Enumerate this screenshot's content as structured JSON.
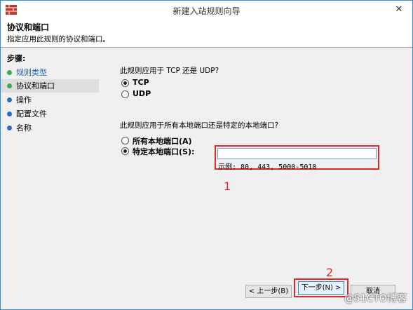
{
  "window": {
    "title": "新建入站规则向导",
    "close_icon": "close-icon",
    "accent": "#2b8fd8"
  },
  "header": {
    "title": "协议和端口",
    "subtitle": "指定应用此规则的协议和端口。"
  },
  "sidebar": {
    "heading": "步骤:",
    "steps": [
      {
        "label": "规则类型",
        "state": "done"
      },
      {
        "label": "协议和端口",
        "state": "current"
      },
      {
        "label": "操作",
        "state": "pending"
      },
      {
        "label": "配置文件",
        "state": "pending"
      },
      {
        "label": "名称",
        "state": "pending"
      }
    ]
  },
  "protocol": {
    "question": "此规则应用于 TCP 还是 UDP?",
    "options": [
      {
        "label": "TCP",
        "selected": true
      },
      {
        "label": "UDP",
        "selected": false
      }
    ]
  },
  "ports": {
    "question": "此规则应用于所有本地端口还是特定的本地端口?",
    "options": [
      {
        "label": "所有本地端口(A)",
        "selected": false
      },
      {
        "label": "特定本地端口(S):",
        "selected": true
      }
    ],
    "input_value": "",
    "hint": "示例: 80, 443, 5000-5010"
  },
  "annotations": {
    "one": "1",
    "two": "2",
    "color": "#e0282b"
  },
  "footer": {
    "back_label": "< 上一步(B)",
    "next_label": "下一步(N) >",
    "cancel_label": "取消"
  },
  "watermark": "@51CTO博客"
}
